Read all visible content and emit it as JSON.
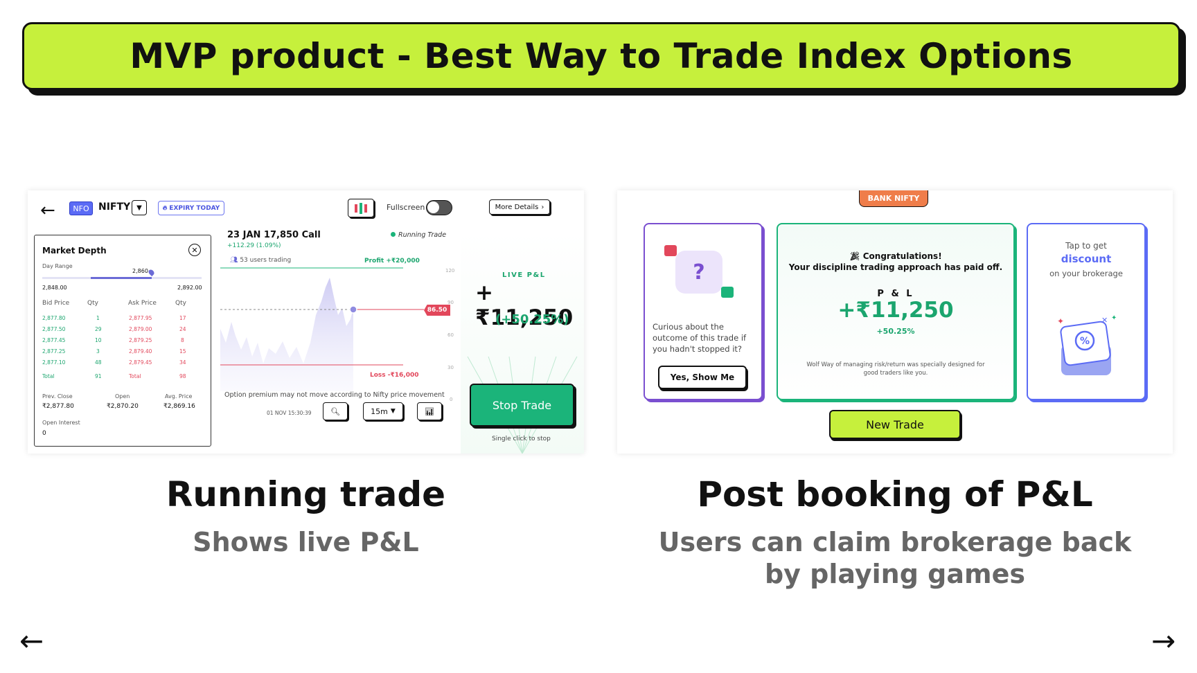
{
  "banner": {
    "title": "MVP product - Best Way to Trade Index Options"
  },
  "colors": {
    "accent_lime": "#c6f03c",
    "profit_green": "#1bb47a",
    "loss_red": "#e2475b",
    "brand_purple": "#7a4fd0",
    "brand_blue": "#5b6bf5",
    "tag_orange": "#ef7d4a"
  },
  "running": {
    "topbar": {
      "back_icon": "arrow-left-icon",
      "segment": "NFO",
      "symbol": "NIFTY",
      "expiry": "EXPIRY TODAY",
      "fullscreen_label": "Fullscreen",
      "more_details": "More Details"
    },
    "market_depth": {
      "title": "Market Depth",
      "day_range_label": "Day Range",
      "day_low": "2,848.00",
      "day_high": "2,892.00",
      "current_marker": "2,860",
      "headers": [
        "Bid Price",
        "Qty",
        "Ask Price",
        "Qty"
      ],
      "rows": [
        {
          "bid": "2,877.80",
          "bid_qty": "1",
          "ask": "2,877.95",
          "ask_qty": "17"
        },
        {
          "bid": "2,877.50",
          "bid_qty": "29",
          "ask": "2,879.00",
          "ask_qty": "24"
        },
        {
          "bid": "2,877.45",
          "bid_qty": "10",
          "ask": "2,879.25",
          "ask_qty": "8"
        },
        {
          "bid": "2,877.25",
          "bid_qty": "3",
          "ask": "2,879.40",
          "ask_qty": "15"
        },
        {
          "bid": "2,877.10",
          "bid_qty": "48",
          "ask": "2,879.45",
          "ask_qty": "34"
        }
      ],
      "total_label": "Total",
      "total_bid_qty": "91",
      "total_ask_qty": "98",
      "prev_close_label": "Prev. Close",
      "prev_close": "₹2,877.80",
      "open_label": "Open",
      "open": "₹2,870.20",
      "avg_price_label": "Avg. Price",
      "avg_price": "₹2,869.16",
      "open_interest_label": "Open Interest",
      "open_interest": "0"
    },
    "option": {
      "title": "23 JAN 17,850 Call",
      "change": "+112.29 (1.09%)",
      "status": "Running Trade",
      "users": "53 users trading",
      "profit_target": "Profit +₹20,000",
      "loss_limit": "Loss -₹16,000",
      "current_price": "86.50",
      "axis_ticks": [
        "120",
        "90",
        "60",
        "30",
        "0"
      ],
      "note": "Option premium may not move according to Nifty price movement",
      "timestamp": "01 NOV 15:30:39",
      "interval": "15m"
    },
    "live": {
      "label": "LIVE P&L",
      "value": "+₹11,250",
      "pct": "(+50.25%)",
      "stop_button": "Stop Trade",
      "stop_hint": "Single click to stop"
    }
  },
  "post": {
    "tag": "BANK NIFTY",
    "left_card": {
      "question": "Curious about the outcome of this trade if you hadn't stopped it?",
      "button": "Yes, Show Me"
    },
    "mid_card": {
      "title_line1": "Congratulations!",
      "title_line2": "Your discipline trading approach has paid off.",
      "pl_label": "P & L",
      "value": "+₹11,250",
      "pct": "+50.25%",
      "note": "Wolf Way of managing risk/return was specially designed for good traders like you."
    },
    "right_card": {
      "tap": "Tap to get",
      "discount": "discount",
      "brokerage": "on your brokerage"
    },
    "new_trade_button": "New Trade"
  },
  "captions": {
    "left_title": "Running trade",
    "left_sub": "Shows live P&L",
    "right_title": "Post booking of P&L",
    "right_sub": "Users can claim brokerage back by playing games"
  },
  "nav": {
    "prev_icon": "arrow-left-icon",
    "next_icon": "arrow-right-icon"
  }
}
